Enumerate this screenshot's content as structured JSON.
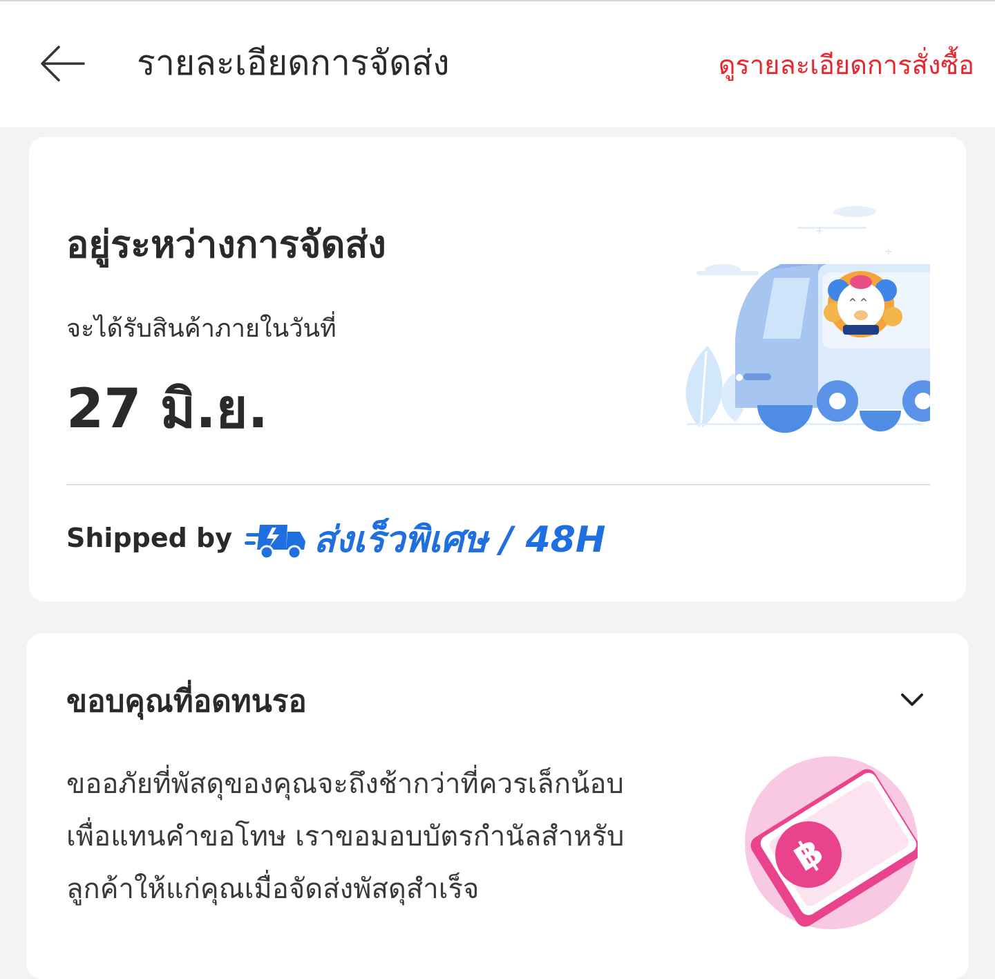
{
  "header": {
    "back_icon": "arrow-left-icon",
    "title": "รายละเอียดการจัดส่ง",
    "order_details_link": "ดูรายละเอียดการสั่งซื้อ"
  },
  "shipment": {
    "status_title": "อยู่ระหว่างการจัดส่ง",
    "receive_label": "จะได้รับสินค้าภายในวันที่",
    "delivery_date": "27 มิ.ย.",
    "illustration": "delivery-van-mascot-illustration",
    "shipped_by_label": "Shipped by",
    "service_icon": "fast-truck-icon",
    "service_name": "ส่งเร็วพิเศษ / 48H"
  },
  "apology": {
    "title": "ขอบคุณที่อดทนรอ",
    "expand_icon": "chevron-down-icon",
    "lines": [
      "ขออภัยที่พัสดุของคุณจะถึงช้ากว่าที่ควรเล็กน้อบ",
      "เพื่อแทนคำขอโทษ เราขอมอบบัตรกำนัลสำหรับ",
      "ลูกค้าให้แก่คุณเมื่อจัดส่งพัสดุสำเร็จ"
    ],
    "voucher_icon": "baht-voucher-icon"
  },
  "colors": {
    "accent_red": "#e8262b",
    "service_blue": "#1f6fe0",
    "page_bg": "#f3f3f3"
  }
}
